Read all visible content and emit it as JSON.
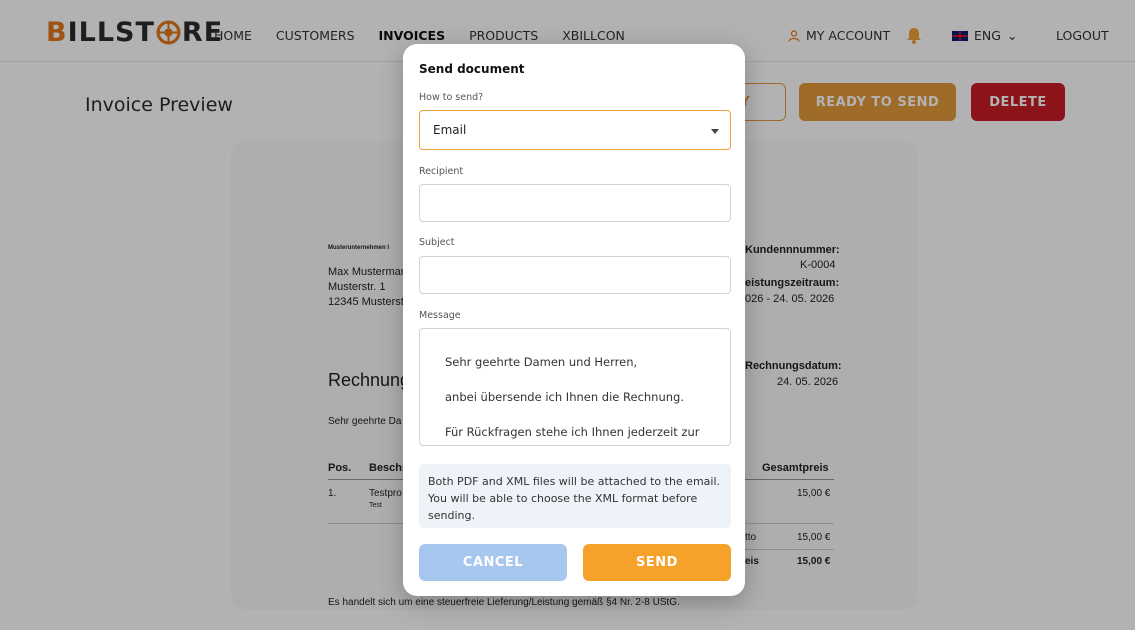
{
  "brand": {
    "logo_prefix": "B",
    "logo_mid": "ILLST",
    "logo_suffix": "RE"
  },
  "nav": {
    "items": [
      "HOME",
      "CUSTOMERS",
      "INVOICES",
      "PRODUCTS",
      "XBILLCON"
    ],
    "active": "INVOICES",
    "account": "MY ACCOUNT",
    "language": "ENG",
    "logout": "LOGOUT"
  },
  "page": {
    "title": "Invoice Preview",
    "verify_label": "FY",
    "ready_label": "READY TO SEND",
    "delete_label": "DELETE"
  },
  "document": {
    "sender_line": "Musterunternehmen I",
    "recipient_name": "Max Musterman",
    "recipient_street": "Musterstr. 1",
    "recipient_city": "12345 Musterst",
    "customer_no_label": "Kundennnummer:",
    "customer_no": "K-0004",
    "period_label": "eistungszeitraum:",
    "period": "026 - 24. 05. 2026",
    "date_label": "Rechnungsdatum:",
    "date": "24. 05. 2026",
    "heading": "Rechnung",
    "greeting": "Sehr geehrte Da",
    "col_pos": "Pos.",
    "col_desc": "Beschr",
    "col_total": "Gesamtpreis",
    "row_pos": "1.",
    "row_desc": "Testpro",
    "row_sub": "Test",
    "row_total": "15,00 €",
    "net_label": "tto",
    "net_value": "15,00 €",
    "gross_label": "eis",
    "gross_value": "15,00 €",
    "footer": "Es handelt sich um eine steuerfreie Lieferung/Leistung gemäß §4 Nr. 2-8 UStG."
  },
  "modal": {
    "title": "Send document",
    "how_label": "How to send?",
    "how_value": "Email",
    "recipient_label": "Recipient",
    "recipient_value": "",
    "subject_label": "Subject",
    "subject_value": "",
    "message_label": "Message",
    "message_lines": [
      "Sehr geehrte Damen und Herren,",
      "anbei übersende ich Ihnen die Rechnung.",
      "Für Rückfragen stehe ich Ihnen jederzeit zur"
    ],
    "note_lines": [
      "Both PDF and XML files will be attached to the email.",
      "You will be able to choose the XML format before",
      "sending."
    ],
    "cancel_label": "CANCEL",
    "send_label": "SEND"
  },
  "colors": {
    "accent": "#f5a12a",
    "danger": "#c81c24",
    "cancel": "#a8c7ef",
    "note_bg": "#eef2f9"
  }
}
